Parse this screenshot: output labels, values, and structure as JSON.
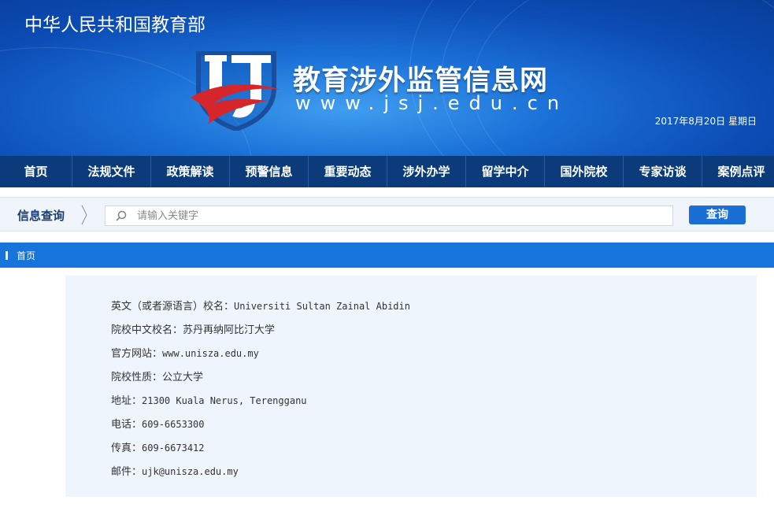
{
  "header": {
    "ministry": "中华人民共和国教育部",
    "site_name": "教育涉外监管信息网",
    "site_url": "www.jsj.edu.cn",
    "date": "2017年8月20日  星期日"
  },
  "nav": {
    "items": [
      "首页",
      "法规文件",
      "政策解读",
      "预警信息",
      "重要动态",
      "涉外办学",
      "留学中介",
      "国外院校",
      "专家访谈",
      "案例点评"
    ]
  },
  "search": {
    "label": "信息查询",
    "placeholder": "请输入关键字",
    "value": "",
    "button_label": "查询"
  },
  "breadcrumb": {
    "home": "首页"
  },
  "info": {
    "rows": [
      {
        "label": "英文（或者源语言）校名：",
        "value": "Universiti Sultan Zainal Abidin"
      },
      {
        "label": "院校中文校名：",
        "value": "苏丹再纳阿比汀大学"
      },
      {
        "label": "官方网站：",
        "value": "www.unisza.edu.my"
      },
      {
        "label": "院校性质：",
        "value": "公立大学"
      },
      {
        "label": "地址：",
        "value": "21300 Kuala Nerus, Terengganu"
      },
      {
        "label": "电话：",
        "value": "609-6653300"
      },
      {
        "label": "传真：",
        "value": "609-6673412"
      },
      {
        "label": "邮件：",
        "value": "ujk@unisza.edu.my"
      }
    ]
  },
  "colors": {
    "nav_bg": "#0b3b7a",
    "accent": "#1575db",
    "panel_bg": "#eef5fd",
    "logo_red": "#d7262b"
  }
}
